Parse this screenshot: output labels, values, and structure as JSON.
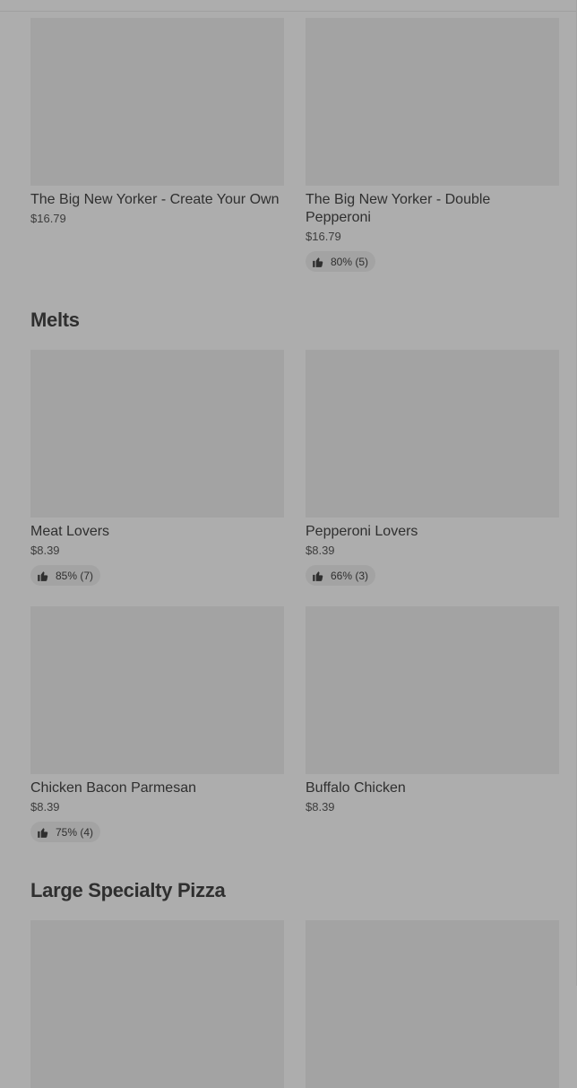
{
  "sections": [
    {
      "items": [
        {
          "name": "The Big New Yorker - Create Your Own",
          "price": "$16.79",
          "rating": null
        },
        {
          "name": "The Big New Yorker - Double Pepperoni",
          "price": "$16.79",
          "rating": "80% (5)"
        }
      ]
    },
    {
      "title": "Melts",
      "items": [
        {
          "name": "Meat Lovers",
          "price": "$8.39",
          "rating": "85% (7)"
        },
        {
          "name": "Pepperoni Lovers",
          "price": "$8.39",
          "rating": "66% (3)"
        },
        {
          "name": "Chicken Bacon Parmesan",
          "price": "$8.39",
          "rating": "75% (4)"
        },
        {
          "name": "Buffalo Chicken",
          "price": "$8.39",
          "rating": null
        }
      ]
    },
    {
      "title": "Large Specialty Pizza",
      "items": [
        {
          "name": "",
          "price": "",
          "rating": null
        },
        {
          "name": "",
          "price": "",
          "rating": null
        }
      ]
    }
  ],
  "icons": {
    "rating": "thumbs-up-icon"
  },
  "colors": {
    "background": "#adadad",
    "placeholder": "#a3a3a3",
    "text": "#2f2f2f"
  }
}
